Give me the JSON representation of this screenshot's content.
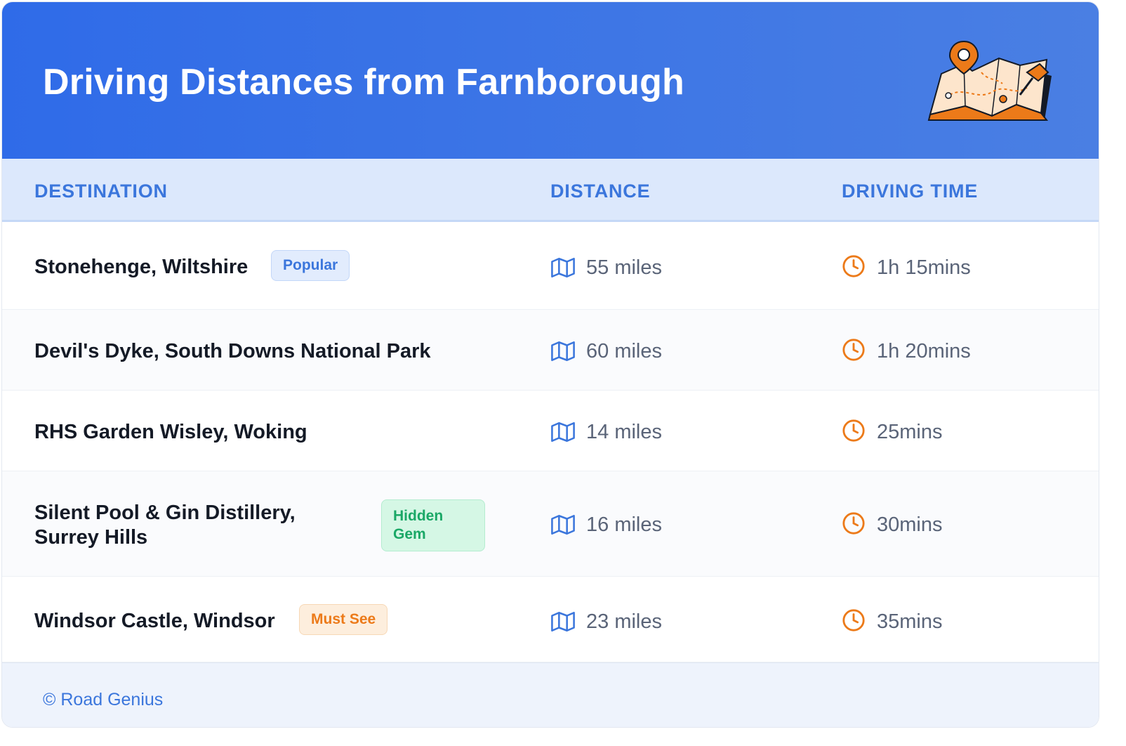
{
  "header": {
    "title": "Driving Distances from Farnborough"
  },
  "columns": {
    "destination": "DESTINATION",
    "distance": "DISTANCE",
    "driving_time": "DRIVING TIME"
  },
  "rows": [
    {
      "destination": "Stonehenge, Wiltshire",
      "badge": "Popular",
      "distance": "55 miles",
      "time": "1h 15mins"
    },
    {
      "destination": "Devil's Dyke, South Downs National Park",
      "badge": "",
      "distance": "60 miles",
      "time": "1h 20mins"
    },
    {
      "destination": "RHS Garden Wisley, Woking",
      "badge": "",
      "distance": "14 miles",
      "time": "25mins"
    },
    {
      "destination_line1": "Silent Pool & Gin Distillery,",
      "destination_line2": "Surrey Hills",
      "badge_line1": "Hidden",
      "badge_line2": "Gem",
      "distance": "16 miles",
      "time": "30mins"
    },
    {
      "destination": "Windsor Castle, Windsor",
      "badge": "Must See",
      "distance": "23 miles",
      "time": "35mins"
    }
  ],
  "footer": {
    "brand": "© Road Genius"
  },
  "icons": {
    "distance": "map-icon",
    "time": "clock-icon",
    "header": "map-pin-illustration"
  },
  "colors": {
    "header_start": "#2f6be8",
    "header_end": "#4a7fe3",
    "accent_blue": "#3b76dc",
    "accent_orange": "#ec7a19",
    "accent_green": "#1aa866"
  }
}
